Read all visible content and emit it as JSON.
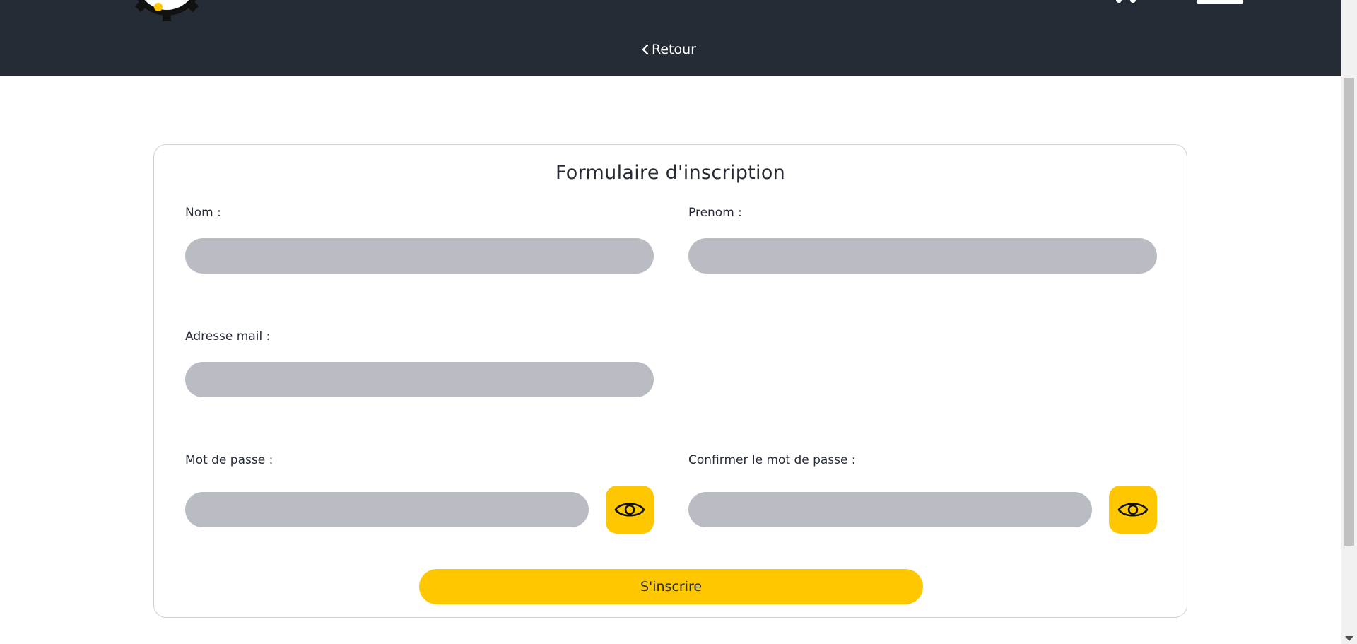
{
  "header": {
    "back_label": "Retour",
    "background_color": "#262c36"
  },
  "form": {
    "title": "Formulaire d'inscription",
    "fields": {
      "nom": {
        "label": "Nom :",
        "value": ""
      },
      "prenom": {
        "label": "Prenom :",
        "value": ""
      },
      "email": {
        "label": "Adresse mail :",
        "value": ""
      },
      "password": {
        "label": "Mot de passe :",
        "value": ""
      },
      "password_confirm": {
        "label": "Confirmer le mot de passe :",
        "value": ""
      }
    },
    "submit_label": "S'inscrire"
  },
  "icons": {
    "back": "chevron-left-icon",
    "toggle_password": "eye-icon",
    "logo": "gear-logo",
    "cart": "cart-icon"
  },
  "colors": {
    "accent": "#ffc700",
    "input_bg": "#b9bcc3",
    "text": "#262c36",
    "card_border": "#cfd2d7"
  }
}
